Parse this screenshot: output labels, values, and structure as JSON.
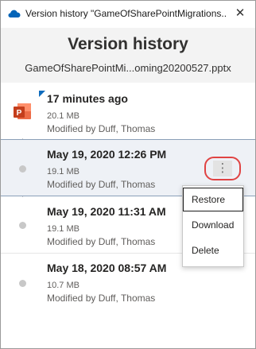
{
  "window": {
    "title": "Version history \"GameOfSharePointMigrations..."
  },
  "header": {
    "heading": "Version history",
    "filename": "GameOfSharePointMi...oming20200527.pptx"
  },
  "versions": [
    {
      "date": "17 minutes ago",
      "size": "20.1 MB",
      "author": "Modified by Duff, Thomas",
      "icon": "powerpoint-icon"
    },
    {
      "date": "May 19, 2020 12:26 PM",
      "size": "19.1 MB",
      "author": "Modified by Duff, Thomas"
    },
    {
      "date": "May 19, 2020 11:31 AM",
      "size": "19.1 MB",
      "author": "Modified by Duff, Thomas"
    },
    {
      "date": "May 18, 2020 08:57 AM",
      "size": "10.7 MB",
      "author": "Modified by Duff, Thomas"
    }
  ],
  "context_menu": {
    "items": [
      "Restore",
      "Download",
      "Delete"
    ]
  },
  "colors": {
    "highlight_ring": "#e04343",
    "selected_row": "#eef1f6",
    "powerpoint": "#c43e1c",
    "onedrive": "#0364b8"
  }
}
